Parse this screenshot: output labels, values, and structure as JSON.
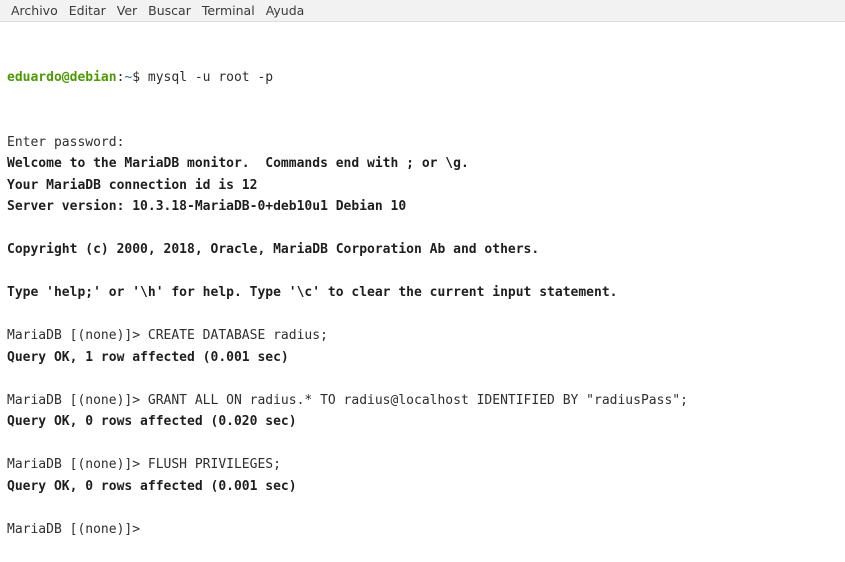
{
  "menubar": {
    "items": [
      "Archivo",
      "Editar",
      "Ver",
      "Buscar",
      "Terminal",
      "Ayuda"
    ]
  },
  "terminal": {
    "shell_prompt": {
      "user_host": "eduardo@debian",
      "separator": ":",
      "cwd": "~",
      "symbol": "$ ",
      "command": "mysql -u root -p"
    },
    "lines": [
      {
        "text": "Enter password:",
        "style": "normal"
      },
      {
        "text": "Welcome to the MariaDB monitor.  Commands end with ; or \\g.",
        "style": "bold"
      },
      {
        "text": "Your MariaDB connection id is 12",
        "style": "bold"
      },
      {
        "text": "Server version: 10.3.18-MariaDB-0+deb10u1 Debian 10",
        "style": "bold"
      },
      {
        "text": "",
        "style": "normal"
      },
      {
        "text": "Copyright (c) 2000, 2018, Oracle, MariaDB Corporation Ab and others.",
        "style": "bold"
      },
      {
        "text": "",
        "style": "normal"
      },
      {
        "text": "Type 'help;' or '\\h' for help. Type '\\c' to clear the current input statement.",
        "style": "bold"
      },
      {
        "text": "",
        "style": "normal"
      },
      {
        "text": "MariaDB [(none)]> CREATE DATABASE radius;",
        "style": "normal"
      },
      {
        "text": "Query OK, 1 row affected (0.001 sec)",
        "style": "bold"
      },
      {
        "text": "",
        "style": "normal"
      },
      {
        "text": "MariaDB [(none)]> GRANT ALL ON radius.* TO radius@localhost IDENTIFIED BY \"radiusPass\";",
        "style": "normal"
      },
      {
        "text": "Query OK, 0 rows affected (0.020 sec)",
        "style": "bold"
      },
      {
        "text": "",
        "style": "normal"
      },
      {
        "text": "MariaDB [(none)]> FLUSH PRIVILEGES;",
        "style": "normal"
      },
      {
        "text": "Query OK, 0 rows affected (0.001 sec)",
        "style": "bold"
      },
      {
        "text": "",
        "style": "normal"
      },
      {
        "text": "MariaDB [(none)]>",
        "style": "normal"
      }
    ]
  }
}
